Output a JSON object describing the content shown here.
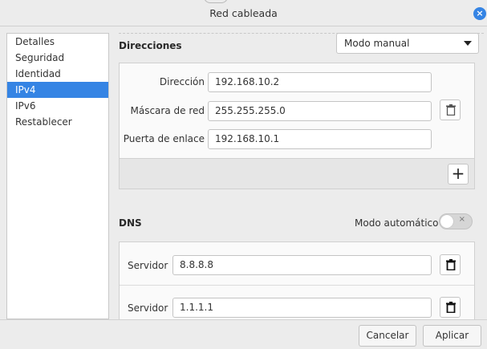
{
  "window": {
    "title": "Red cableada"
  },
  "sidebar": {
    "items": [
      {
        "label": "Detalles",
        "active": false
      },
      {
        "label": "Seguridad",
        "active": false
      },
      {
        "label": "Identidad",
        "active": false
      },
      {
        "label": "IPv4",
        "active": true
      },
      {
        "label": "IPv6",
        "active": false
      },
      {
        "label": "Restablecer",
        "active": false
      }
    ]
  },
  "addresses": {
    "title": "Direcciones",
    "mode": "Modo manual",
    "address_label": "Dirección",
    "address_value": "192.168.10.2",
    "netmask_label": "Máscara de red",
    "netmask_value": "255.255.255.0",
    "gateway_label": "Puerta de enlace",
    "gateway_value": "192.168.10.1",
    "add_symbol": "+"
  },
  "dns": {
    "title": "DNS",
    "auto_label": "Modo automático",
    "auto_enabled": false,
    "toggle_off_symbol": "×",
    "servers": [
      {
        "label": "Servidor",
        "value": "8.8.8.8"
      },
      {
        "label": "Servidor",
        "value": "1.1.1.1"
      }
    ]
  },
  "buttons": {
    "cancel": "Cancelar",
    "apply": "Aplicar",
    "close_symbol": "×"
  },
  "colors": {
    "accent": "#3584e4"
  },
  "icons": {
    "delete": "trash-icon",
    "add": "plus-icon",
    "close": "close-icon",
    "dropdown": "chevron-down-icon"
  }
}
